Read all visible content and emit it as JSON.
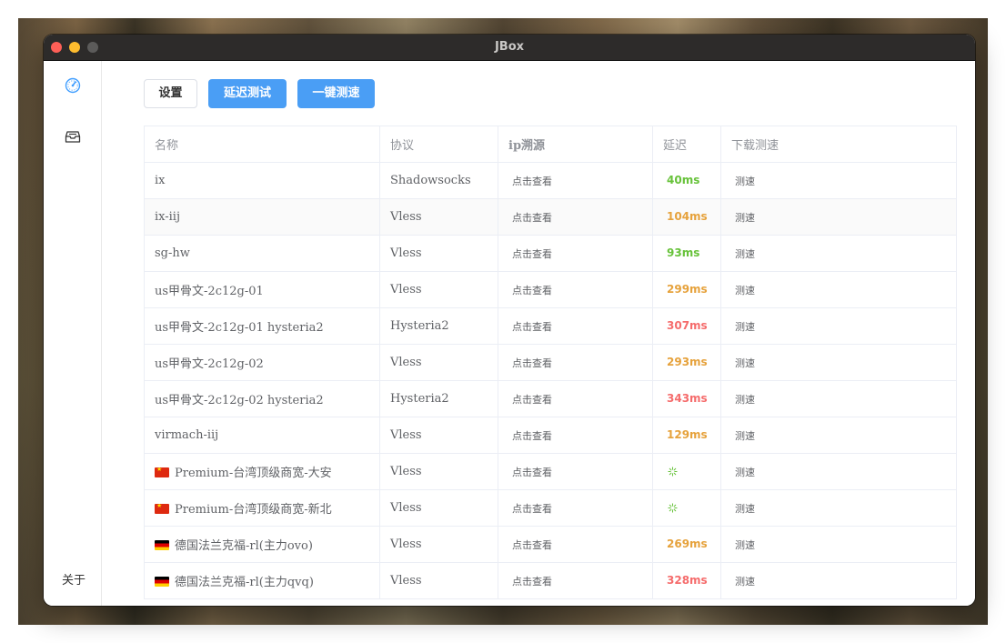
{
  "window": {
    "title": "JBox"
  },
  "sidebar": {
    "about_label": "关于"
  },
  "toolbar": {
    "settings_label": "设置",
    "latency_test_label": "延迟测试",
    "speed_test_label": "一键测速"
  },
  "table": {
    "headers": {
      "name": "名称",
      "protocol": "协议",
      "ip": "ip溯源",
      "latency": "延迟",
      "download": "下载测速"
    },
    "rows": [
      {
        "name": "ix",
        "protocol": "Shadowsocks",
        "ip_action": "点击查看",
        "latency": "40ms",
        "latency_color": "#67c23a",
        "download_action": "测速"
      },
      {
        "name": "ix-iij",
        "protocol": "Vless",
        "ip_action": "点击查看",
        "latency": "104ms",
        "latency_color": "#e6a23c",
        "download_action": "测速"
      },
      {
        "name": "sg-hw",
        "protocol": "Vless",
        "ip_action": "点击查看",
        "latency": "93ms",
        "latency_color": "#67c23a",
        "download_action": "测速"
      },
      {
        "name": "us甲骨文-2c12g-01",
        "protocol": "Vless",
        "ip_action": "点击查看",
        "latency": "299ms",
        "latency_color": "#e6a23c",
        "download_action": "测速"
      },
      {
        "name": "us甲骨文-2c12g-01 hysteria2",
        "protocol": "Hysteria2",
        "ip_action": "点击查看",
        "latency": "307ms",
        "latency_color": "#f56c6c",
        "download_action": "测速"
      },
      {
        "name": "us甲骨文-2c12g-02",
        "protocol": "Vless",
        "ip_action": "点击查看",
        "latency": "293ms",
        "latency_color": "#e6a23c",
        "download_action": "测速"
      },
      {
        "name": "us甲骨文-2c12g-02 hysteria2",
        "protocol": "Hysteria2",
        "ip_action": "点击查看",
        "latency": "343ms",
        "latency_color": "#f56c6c",
        "download_action": "测速"
      },
      {
        "name": "virmach-iij",
        "protocol": "Vless",
        "ip_action": "点击查看",
        "latency": "129ms",
        "latency_color": "#e6a23c",
        "download_action": "测速"
      },
      {
        "name": "Premium-台湾顶级商宽-大安",
        "flag": "cn",
        "protocol": "Vless",
        "ip_action": "点击查看",
        "latency": "",
        "loading": true,
        "download_action": "测速"
      },
      {
        "name": "Premium-台湾顶级商宽-新北",
        "flag": "cn",
        "protocol": "Vless",
        "ip_action": "点击查看",
        "latency": "",
        "loading": true,
        "download_action": "测速"
      },
      {
        "name": "德国法兰克福-rl(主力ovo)",
        "flag": "de",
        "protocol": "Vless",
        "ip_action": "点击查看",
        "latency": "269ms",
        "latency_color": "#e6a23c",
        "download_action": "测速"
      },
      {
        "name": "德国法兰克福-rl(主力qvq)",
        "flag": "de",
        "protocol": "Vless",
        "ip_action": "点击查看",
        "latency": "328ms",
        "latency_color": "#f56c6c",
        "download_action": "测速"
      }
    ]
  },
  "colors": {
    "primary": "#4a9ef5",
    "good": "#67c23a",
    "warn": "#e6a23c",
    "bad": "#f56c6c"
  },
  "icons": {
    "sidebar_top": "speedometer-icon",
    "sidebar_second": "inbox-icon"
  }
}
